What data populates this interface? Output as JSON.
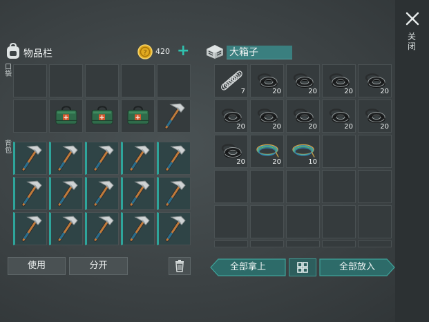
{
  "inventory": {
    "title": "物品栏",
    "pocket_label": "口袋",
    "backpack_label": "背包",
    "coin_count": "420",
    "pocket_slots": [
      {
        "item": "",
        "count": ""
      },
      {
        "item": "",
        "count": ""
      },
      {
        "item": "",
        "count": ""
      },
      {
        "item": "",
        "count": ""
      },
      {
        "item": "",
        "count": ""
      },
      {
        "item": "",
        "count": ""
      },
      {
        "item": "medkit-bag",
        "count": ""
      },
      {
        "item": "medkit-bag",
        "count": ""
      },
      {
        "item": "medkit-bag",
        "count": ""
      },
      {
        "item": "hatchet",
        "count": ""
      }
    ],
    "backpack_slots": [
      {
        "item": "hatchet"
      },
      {
        "item": "hatchet"
      },
      {
        "item": "hatchet"
      },
      {
        "item": "hatchet"
      },
      {
        "item": "hatchet"
      },
      {
        "item": "hatchet"
      },
      {
        "item": "hatchet"
      },
      {
        "item": "hatchet"
      },
      {
        "item": "hatchet"
      },
      {
        "item": "hatchet"
      },
      {
        "item": "hatchet"
      },
      {
        "item": "hatchet"
      },
      {
        "item": "hatchet"
      },
      {
        "item": "hatchet"
      },
      {
        "item": "hatchet"
      }
    ],
    "use_label": "使用",
    "split_label": "分开"
  },
  "chest": {
    "name": "大箱子",
    "slots": [
      {
        "item": "spring",
        "count": "7"
      },
      {
        "item": "tire",
        "count": "20"
      },
      {
        "item": "tire",
        "count": "20"
      },
      {
        "item": "tire",
        "count": "20"
      },
      {
        "item": "tire",
        "count": "20"
      },
      {
        "item": "tire",
        "count": "20"
      },
      {
        "item": "tire",
        "count": "20"
      },
      {
        "item": "tire",
        "count": "20"
      },
      {
        "item": "tire",
        "count": "20"
      },
      {
        "item": "tire",
        "count": "20"
      },
      {
        "item": "tire",
        "count": "20"
      },
      {
        "item": "wire",
        "count": "20"
      },
      {
        "item": "wire",
        "count": "10"
      },
      {
        "item": "",
        "count": ""
      },
      {
        "item": "",
        "count": ""
      },
      {
        "item": "",
        "count": ""
      },
      {
        "item": "",
        "count": ""
      },
      {
        "item": "",
        "count": ""
      },
      {
        "item": "",
        "count": ""
      },
      {
        "item": "",
        "count": ""
      },
      {
        "item": "",
        "count": ""
      },
      {
        "item": "",
        "count": ""
      },
      {
        "item": "",
        "count": ""
      },
      {
        "item": "",
        "count": ""
      },
      {
        "item": "",
        "count": ""
      },
      {
        "item": "",
        "count": ""
      },
      {
        "item": "",
        "count": ""
      },
      {
        "item": "",
        "count": ""
      },
      {
        "item": "",
        "count": ""
      },
      {
        "item": "",
        "count": ""
      }
    ],
    "take_all_label": "全部拿上",
    "put_all_label": "全部放入"
  },
  "close_label": "关闭",
  "icons": {
    "backpack": "backpack-icon",
    "coin": "coin-icon",
    "chest": "chest-icon",
    "close": "close-icon",
    "trash": "trash-icon",
    "sort": "sort-icon"
  },
  "colors": {
    "accent": "#2fc3b0",
    "background": "#3d4446",
    "button_teal": "#2d6b69"
  }
}
